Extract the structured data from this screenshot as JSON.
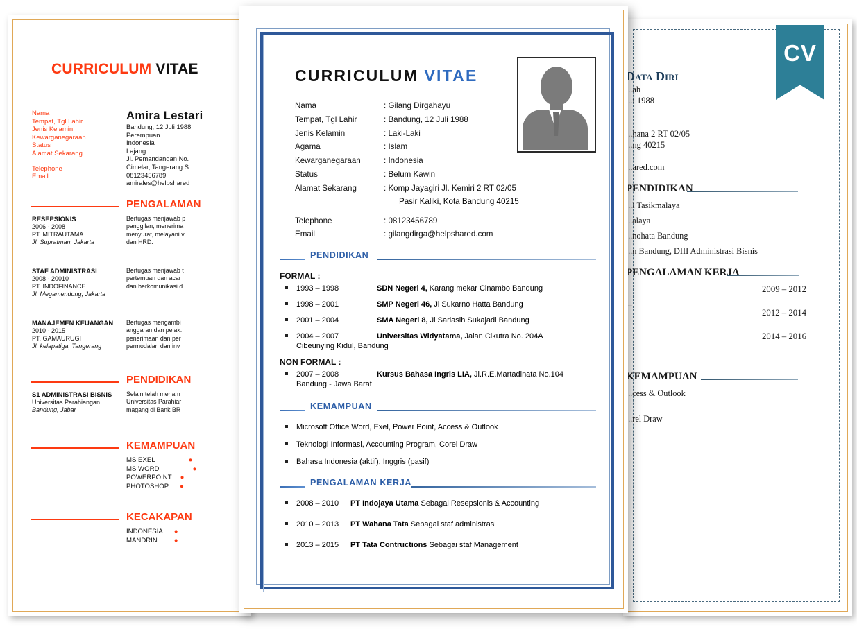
{
  "left_resume": {
    "title_red": "CURRICULUM",
    "title_black": "VITAE",
    "labels": [
      "Nama",
      "Tempat, Tgl Lahir",
      "Jenis Kelamin",
      "Kewarganegaraan",
      "Status",
      "Alamat Sekarang"
    ],
    "labels2": [
      "Telephone",
      "Email"
    ],
    "name": "Amira  Lestari",
    "values": [
      "Bandung, 12 Juli 1988",
      "Perempuan",
      "Indonesia",
      "Lajang",
      "Jl. Pemandangan No.",
      "Cimelar, Tangerang S",
      "08123456789",
      "amirales@helpshared"
    ],
    "sections": {
      "experience": "PENGALAMAN",
      "education": "PENDIDIKAN",
      "skills": "KEMAMPUAN",
      "languages": "KECAKAPAN"
    },
    "experience_items": [
      {
        "role": "RESEPSIONIS",
        "years": "2006 - 2008",
        "company": "PT. MITRAUTAMA",
        "place": "Jl. Supratman, Jakarta",
        "desc": [
          "Bertugas menjawab p",
          "panggilan, menerima",
          "menyurat, melayani v",
          "dan HRD."
        ]
      },
      {
        "role": "STAF ADMINISTRASI",
        "years": "2008 - 20010",
        "company": "PT. INDOFINANCE",
        "place": "Jl. Megamendung, Jakarta",
        "desc": [
          "Bertugas menjawab t",
          "pertemuan dan acar",
          "dan berkomunikasi d"
        ]
      },
      {
        "role": "MANAJEMEN KEUANGAN",
        "years": "2010 - 2015",
        "company": "PT. GAMAURUGI",
        "place": "Jl. kelapatiga, Tangerang",
        "desc": [
          "Bertugas mengambi",
          "anggaran dan pelak:",
          "penerimaan dan per",
          "permodalan dan inv"
        ]
      }
    ],
    "education_item": {
      "degree": "S1 ADMINISTRASI BISNIS",
      "school": "Universitas Parahiangan",
      "place": "Bandung, Jabar",
      "desc": [
        "Selain telah menam",
        "Universitas Parahiar",
        "magang di Bank BR"
      ]
    },
    "skills_list": [
      "MS EXEL",
      "MS WORD",
      "POWERPOINT",
      "PHOTOSHOP"
    ],
    "languages_list": [
      "INDONESIA",
      "MANDRIN"
    ]
  },
  "center_resume": {
    "title_black": "CURRICULUM",
    "title_blue": "VITAE",
    "identity": [
      {
        "label": "Nama",
        "value": ": Gilang Dirgahayu"
      },
      {
        "label": "Tempat, Tgl Lahir",
        "value": ": Bandung, 12 Juli 1988"
      },
      {
        "label": "Jenis Kelamin",
        "value": ": Laki-Laki"
      },
      {
        "label": "Agama",
        "value": ": Islam"
      },
      {
        "label": "Kewarganegaraan",
        "value": ": Indonesia"
      },
      {
        "label": "Status",
        "value": ": Belum Kawin"
      },
      {
        "label": "Alamat Sekarang",
        "value": ": Komp Jayagiri Jl. Kemiri 2 RT 02/05"
      }
    ],
    "address_cont": "Pasir Kaliki, Kota Bandung 40215",
    "contact": [
      {
        "label": "Telephone",
        "value": ": 08123456789"
      },
      {
        "label": "Email",
        "value": ": gilangdirga@helpshared.com"
      }
    ],
    "sections": {
      "education": "PENDIDIKAN",
      "skills": "KEMAMPUAN",
      "experience": "PENGALAMAN KERJA"
    },
    "formal_label": "FORMAL :",
    "nonformal_label": "NON FORMAL :",
    "formal": [
      {
        "years": "1993 – 1998",
        "bold": "SDN Negeri 4,",
        "rest": " Karang mekar Cinambo Bandung",
        "line2": ""
      },
      {
        "years": "1998 – 2001",
        "bold": "SMP Negeri 46,",
        "rest": " Jl Sukarno Hatta Bandung",
        "line2": ""
      },
      {
        "years": "2001 – 2004",
        "bold": "SMA Negeri 8,",
        "rest": " Jl Sariasih  Sukajadi Bandung",
        "line2": ""
      },
      {
        "years": "2004 – 2007",
        "bold": "Universitas Widyatama,",
        "rest": "  Jalan Cikutra No. 204A",
        "line2": "Cibeunying Kidul, Bandung"
      }
    ],
    "nonformal": [
      {
        "years": "2007 – 2008",
        "bold": "Kursus Bahasa Ingris LIA,",
        "rest": " Jl.R.E.Martadinata No.104",
        "line2": "Bandung - Jawa Barat"
      }
    ],
    "skills": [
      "Microsoft  Office Word,  Exel,  Power Point,  Access  &  Outlook",
      "Teknologi Informasi,  Accounting Program,  Corel Draw",
      "Bahasa Indonesia (aktif),  Inggris  (pasif)"
    ],
    "experience": [
      {
        "years": "2008 – 2010",
        "bold": "PT Indojaya  Utama",
        "rest": " Sebagai Resepsionis  & Accounting"
      },
      {
        "years": "2010 – 2013",
        "bold": "PT Wahana Tata",
        "rest": " Sebagai staf administrasi"
      },
      {
        "years": "2013 – 2015",
        "bold": "PT Tata Contructions",
        "rest": "  Sebagai staf Management"
      }
    ]
  },
  "right_resume": {
    "badge_text": "CV",
    "heading": "Data Diri",
    "lines": [
      "...ah",
      "...i 1988",
      "",
      "",
      "...hana 2 RT 02/05",
      "...ng 40215",
      "",
      "...ared.com"
    ],
    "sections": {
      "education": "PENDIDIKAN",
      "experience": "PENGALAMAN KERJA",
      "skills": "KEMAMPUAN"
    },
    "education_items": [
      "...l Tasikmalaya",
      "...alaya",
      "...nohata Bandung",
      "...n Bandung, DIII Administrasi Bisnis"
    ],
    "experience_items": [
      {
        "years": "2009 – 2012",
        "role": ""
      },
      {
        "years": "2012 – 2014",
        "role": "..."
      },
      {
        "years": "2014 – 2016",
        "role": ""
      }
    ],
    "skills_items": [
      "...cess & Outlook",
      "...rel Draw"
    ]
  },
  "colors": {
    "accent_red": "#fd3a12",
    "accent_blue": "#2e5fa8",
    "badge_teal": "#2d7f97",
    "page_border_tan": "#e0a857",
    "frame_blue": "#2e5899"
  }
}
